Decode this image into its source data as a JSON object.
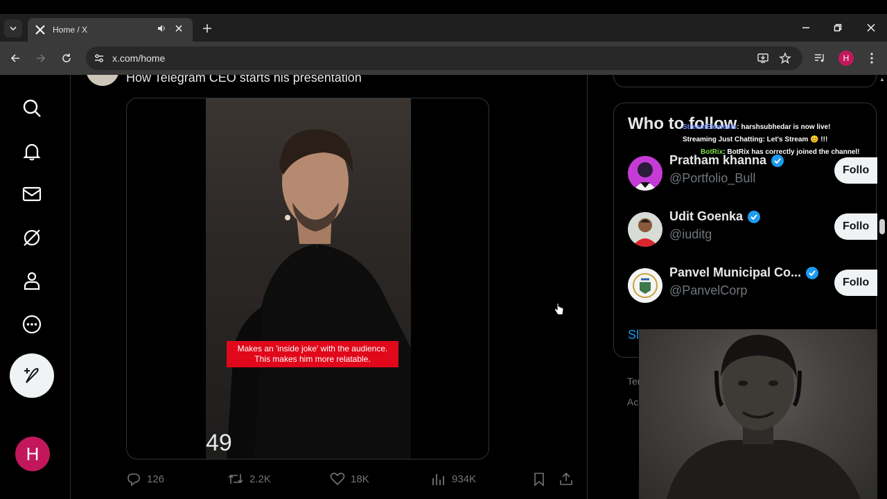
{
  "browser": {
    "tab_title": "Home / X",
    "url": "x.com/home",
    "profile_initial": "H"
  },
  "post": {
    "text": "How Telegram CEO starts his presentation",
    "caption_line1": "Makes an 'inside joke' with the audience.",
    "caption_line2": "This makes him more relatable.",
    "timecode": "49",
    "replies": "126",
    "reposts": "2.2K",
    "likes": "18K",
    "views": "934K"
  },
  "sidebar": {
    "user_initial": "H"
  },
  "who_to_follow": {
    "title": "Who to follow",
    "accounts": [
      {
        "name": "Pratham khanna",
        "handle": "@Portfolio_Bull",
        "button": "Follo"
      },
      {
        "name": "Udit Goenka",
        "handle": "@iuditg",
        "button": "Follo"
      },
      {
        "name": "Panvel Municipal Co...",
        "handle": "@PanvelCorp",
        "button": "Follo"
      }
    ],
    "show_more": "Sl"
  },
  "footer": {
    "line1": "Ter",
    "line2": "Ac"
  },
  "chat": {
    "line1_user": "StreamElements",
    "line1_text": ": harshsubhedar is now live!",
    "line2_text": "Streaming Just Chatting: Let's Stream 😊 !!!",
    "line3_user": "BotRix",
    "line3_text": ": BotRix has correctly joined the channel!"
  },
  "colors": {
    "accent": "#1d9bf0",
    "profile": "#c2185b",
    "caption_bg": "#e0081a"
  }
}
